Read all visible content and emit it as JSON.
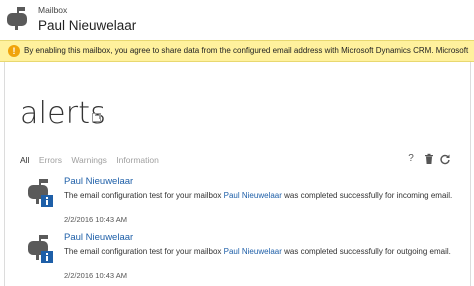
{
  "header": {
    "kicker": "Mailbox",
    "name": "Paul Nieuwelaar",
    "icon": "mailbox-icon"
  },
  "notice": {
    "icon": "warning-icon",
    "text": "By enabling this mailbox, you agree to share data from the configured email address with Microsoft Dynamics CRM. Microsoft"
  },
  "page": {
    "title": "alerts",
    "popout_icon": "popout-icon"
  },
  "filters": [
    "All",
    "Errors",
    "Warnings",
    "Information"
  ],
  "actions": {
    "help": "?",
    "delete_icon": "trash-icon",
    "refresh_icon": "refresh-icon"
  },
  "alerts": [
    {
      "from": "Paul Nieuwelaar",
      "text_before": "The email configuration test for your mailbox ",
      "link": "Paul Nieuwelaar",
      "text_after": " was completed successfully for incoming email.",
      "time": "2/2/2016 10:43 AM"
    },
    {
      "from": "Paul Nieuwelaar",
      "text_before": "The email configuration test for your mailbox ",
      "link": "Paul Nieuwelaar",
      "text_after": " was completed successfully for outgoing email.",
      "time": "2/2/2016 10:43 AM"
    }
  ],
  "colors": {
    "link": "#1e5fa8",
    "notice_bg": "#fff19d",
    "warning": "#f0a30a"
  }
}
